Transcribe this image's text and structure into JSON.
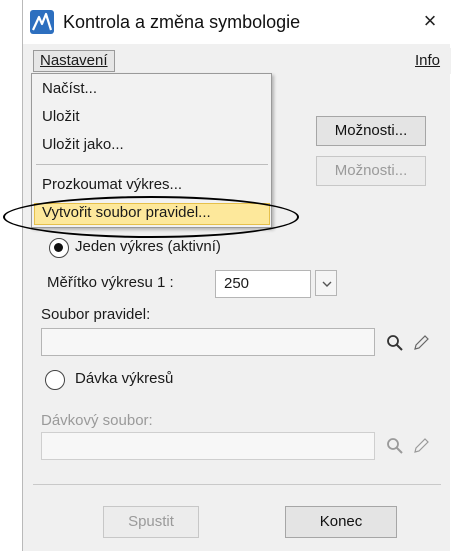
{
  "window": {
    "title": "Kontrola a změna symbologie",
    "close_glyph": "×",
    "app_icon": "bentley-app-icon"
  },
  "menubar": {
    "nastaveni": "Nastavení",
    "info": "Info"
  },
  "dropdown": {
    "items": [
      "Načíst...",
      "Uložit",
      "Uložit jako...",
      "Prozkoumat výkres...",
      "Vytvořit soubor pravidel..."
    ],
    "highlighted_index": 4
  },
  "options": {
    "btn1": "Možnosti...",
    "btn2": "Možnosti..."
  },
  "single": {
    "radio_label": "Jeden výkres (aktivní)",
    "scale_label": "Měřítko výkresu 1 :",
    "scale_value": "250",
    "rules_label": "Soubor pravidel:",
    "rules_value": ""
  },
  "batch": {
    "radio_label": "Dávka výkresů",
    "file_label": "Dávkový soubor:",
    "file_value": ""
  },
  "footer": {
    "run": "Spustit",
    "end": "Konec"
  },
  "icons": {
    "search": "magnifier-icon",
    "edit": "pencil-icon"
  }
}
